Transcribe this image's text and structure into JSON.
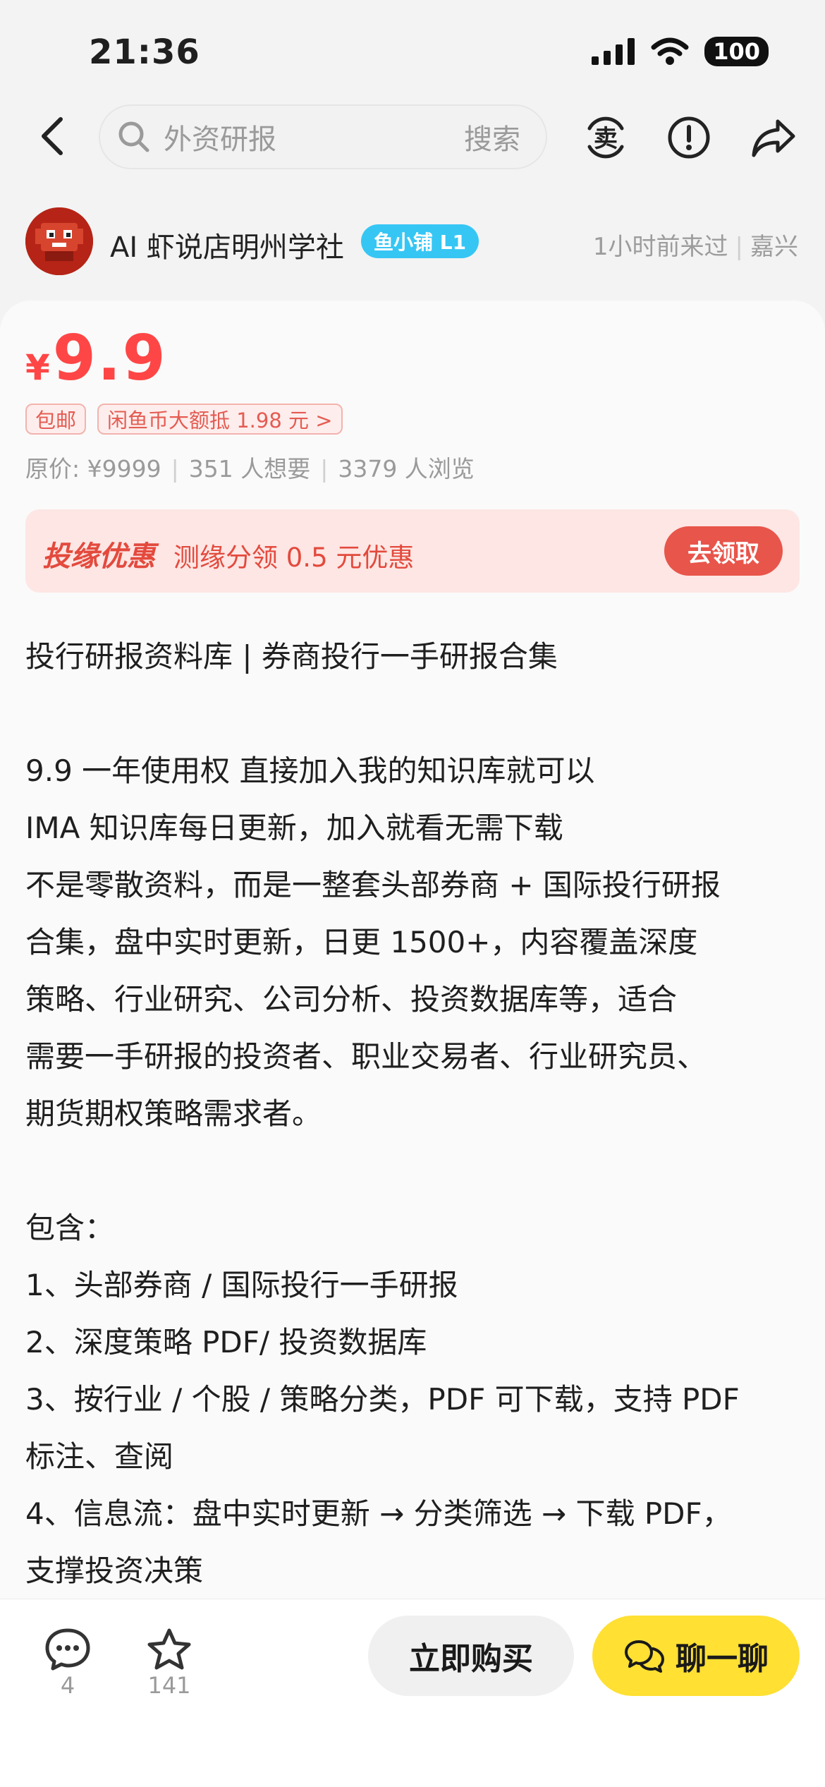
{
  "status_bar": {
    "time": "21:36",
    "battery": "100"
  },
  "nav": {
    "search_placeholder": "外资研报",
    "search_button": "搜索",
    "icons": [
      "back-icon",
      "search-icon",
      "sell-icon",
      "report-icon",
      "share-icon"
    ],
    "sell_icon_glyph": "卖"
  },
  "seller": {
    "name": "AI 虾说店明州学社",
    "badge": "鱼小铺 L1",
    "last_seen": "1小时前来过",
    "location": "嘉兴"
  },
  "product": {
    "price_symbol": "¥",
    "price": "9.9",
    "tags": [
      "包邮",
      "闲鱼币大额抵 1.98 元 >"
    ],
    "original_price": "原价: ¥9999",
    "wants": "351 人想要",
    "views": "3379 人浏览"
  },
  "promo": {
    "title": "投缘优惠",
    "desc": "测缘分领 0.5 元优惠",
    "button": "去领取"
  },
  "description_lines": [
    "投行研报资料库 | 券商投行一手研报合集",
    "",
    "9.9 一年使用权 直接加入我的知识库就可以",
    "IMA 知识库每日更新，加入就看无需下载",
    "不是零散资料，而是一整套头部券商 + 国际投行研报",
    "合集，盘中实时更新，日更 1500+，内容覆盖深度",
    "策略、行业研究、公司分析、投资数据库等，适合",
    "需要一手研报的投资者、职业交易者、行业研究员、",
    "期货期权策略需求者。",
    "",
    "包含：",
    "1、头部券商 / 国际投行一手研报",
    "2、深度策略 PDF/ 投资数据库",
    "3、按行业 / 个股 / 策略分类，PDF 可下载，支持 PDF",
    "标注、查阅",
    "4、信息流：盘中实时更新 → 分类筛选 → 下载 PDF，",
    "支撑投资决策"
  ],
  "bottom_bar": {
    "comments": "4",
    "favorites": "141",
    "buy_button": "立即购买",
    "chat_button": "聊一聊"
  },
  "colors": {
    "price": "#ff4646",
    "accent_yellow": "#ffe033",
    "badge_blue": "#36c6f4",
    "promo_red": "#e8554b"
  }
}
